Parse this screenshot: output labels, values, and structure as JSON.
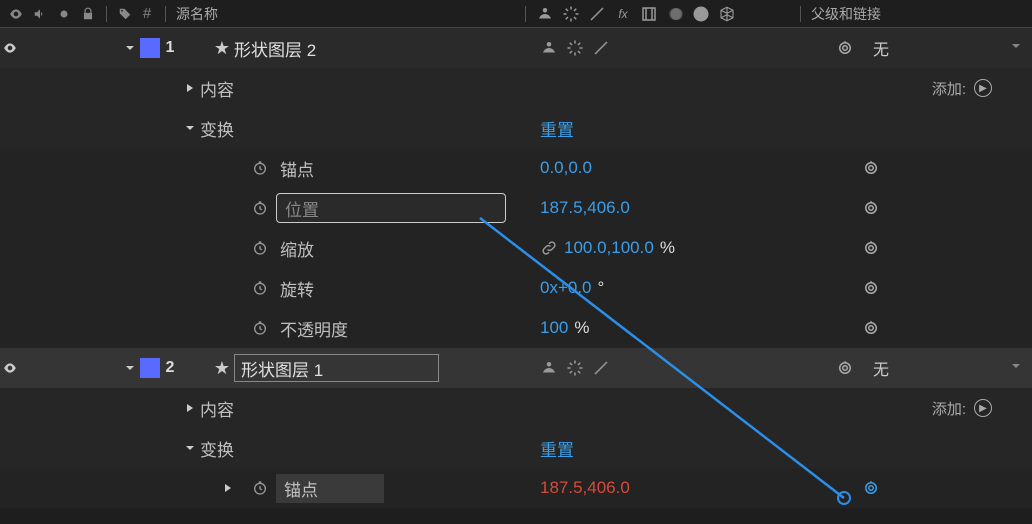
{
  "header": {
    "source_name_label": "源名称",
    "parent_link_label": "父级和链接"
  },
  "layers": [
    {
      "index": "1",
      "name": "形状图层 2",
      "parent": "无",
      "groups": [
        {
          "label": "内容",
          "expanded": false,
          "add_label": "添加:"
        },
        {
          "label": "变换",
          "expanded": true,
          "reset": "重置"
        }
      ],
      "props": [
        {
          "label": "锚点",
          "value": "0.0,0.0"
        },
        {
          "label": "位置",
          "value": "187.5,406.0",
          "selected": true
        },
        {
          "label": "缩放",
          "value": "100.0,100.0",
          "suffix": "%"
        },
        {
          "label": "旋转",
          "value": "0x+0.0",
          "suffix": "°"
        },
        {
          "label": "不透明度",
          "value": "100",
          "suffix": "%"
        }
      ]
    },
    {
      "index": "2",
      "name": "形状图层 1",
      "parent": "无",
      "groups": [
        {
          "label": "内容",
          "expanded": false,
          "add_label": "添加:"
        },
        {
          "label": "变换",
          "expanded": true,
          "reset": "重置"
        }
      ],
      "props": [
        {
          "label": "锚点",
          "value": "187.5,406.0",
          "linked": true
        }
      ]
    }
  ]
}
